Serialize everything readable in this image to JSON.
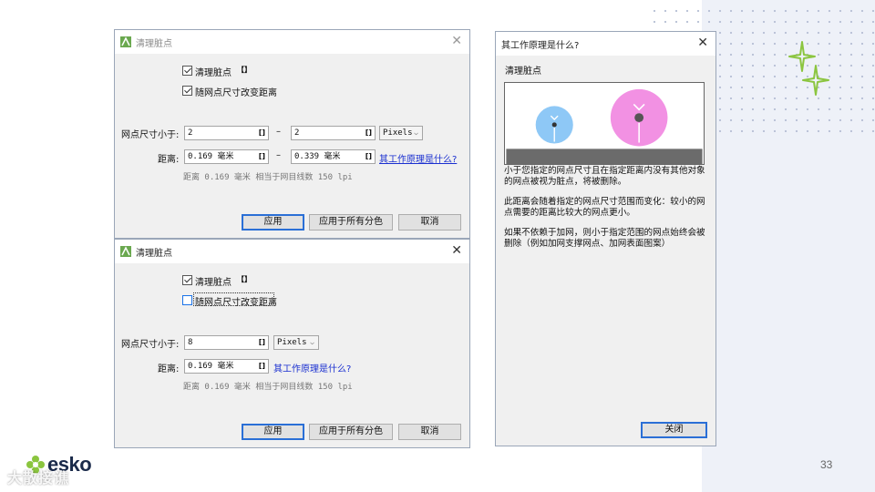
{
  "slide": {
    "page_number": "33"
  },
  "logo": {
    "text": "esko"
  },
  "watermark": {
    "text": "大散接谯"
  },
  "dialog1": {
    "title": "清理脏点",
    "clean_label": "清理脏点",
    "clean_suffix": "【】",
    "vary_label": "随网点尺寸改变距离",
    "size_label": "网点尺寸小于:",
    "size_from": "2",
    "size_to": "2",
    "dash": "–",
    "unit_option": "Pixels",
    "dist_label": "距离:",
    "dist_from_num": "0.169",
    "dist_from_unit": "毫米",
    "dist_to_num": "0.339",
    "dist_to_unit": "毫米",
    "how_link": "其工作原理是什么?",
    "info": "距离 0.169 毫米 相当于网目线数 150 lpi",
    "apply": "应用",
    "apply_all": "应用于所有分色",
    "cancel": "取消"
  },
  "dialog2": {
    "title": "清理脏点",
    "clean_label": "清理脏点",
    "clean_suffix": "【】",
    "vary_label": "随网点尺寸改变距离",
    "size_label": "网点尺寸小于:",
    "size_value": "8",
    "unit_option": "Pixels",
    "dist_label": "距离:",
    "dist_num": "0.169",
    "dist_unit": "毫米",
    "how_link": "其工作原理是什么?",
    "info": "距离 0.169 毫米 相当于网目线数 150 lpi",
    "apply": "应用",
    "apply_all": "应用于所有分色",
    "cancel": "取消"
  },
  "help": {
    "title": "其工作原理是什么?",
    "heading": "清理脏点",
    "p1": "小于您指定的网点尺寸且在指定距离内没有其他对象的网点被视为脏点，将被删除。",
    "p2": "此距离会随着指定的网点尺寸范围而变化：较小的网点需要的距离比较大的网点更小。",
    "p3": "如果不依赖于加网，则小于指定范围的网点始终会被删除（例如加网支撑网点、加网表面图案）",
    "close_label": "关闭"
  },
  "colors": {
    "small_dot": "#8ec8f6",
    "large_dot": "#f291e3",
    "ground": "#6b6b6b",
    "accent_green": "#8bc53f"
  },
  "icons": {
    "close": "close-icon",
    "app": "app-icon",
    "sparkle": "sparkle-icon"
  }
}
